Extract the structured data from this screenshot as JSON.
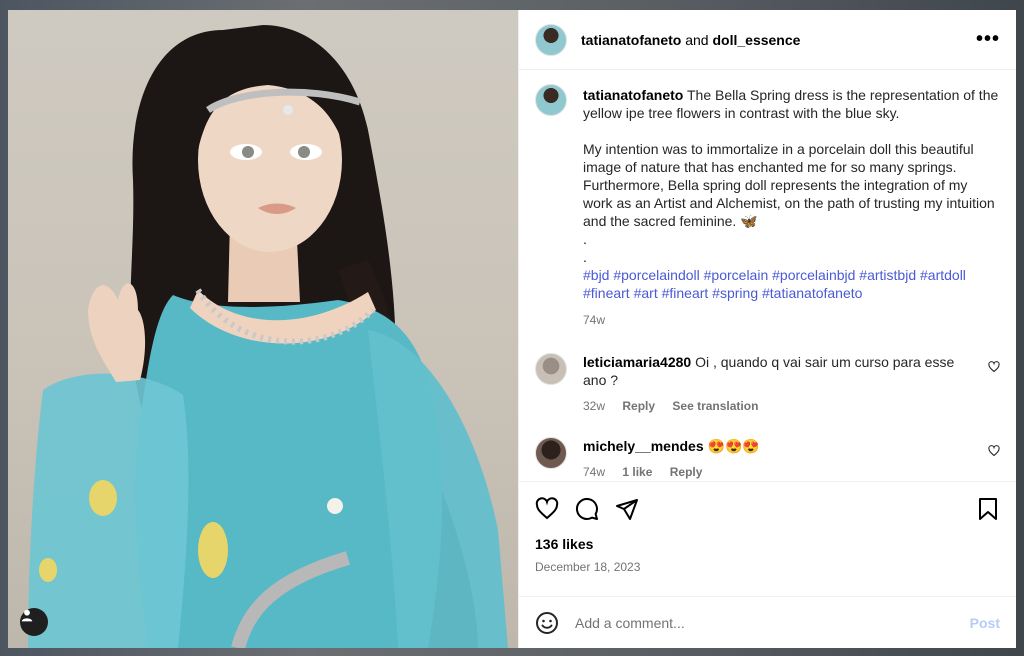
{
  "header": {
    "author": "tatianatofaneto",
    "connector": "and",
    "collaborator": "doll_essence",
    "more_icon": "more-horizontal-icon"
  },
  "caption": {
    "author": "tatianatofaneto",
    "line1": "The Bella Spring dress is the representation of the yellow ipe tree flowers in contrast with the blue sky.",
    "line2": "My intention was to immortalize in a porcelain doll this beautiful image of nature that has enchanted me for so many springs. Furthermore, Bella spring doll represents the integration of my work as an Artist and Alchemist, on the path of trusting my intuition and the sacred feminine. 🦋",
    "dots": ".\n.",
    "hashtags": "#bjd #porcelaindoll #porcelain #porcelainbjd #artistbjd #artdoll #fineart #art #fineart #spring #tatianatofaneto",
    "age": "74w"
  },
  "comments": [
    {
      "user": "leticiamaria4280",
      "text": "Oi , quando q vai sair um curso para esse ano ?",
      "age": "32w",
      "reply": "Reply",
      "translate": "See translation"
    },
    {
      "user": "michely__mendes",
      "text": "😍😍😍",
      "age": "74w",
      "likes": "1 like",
      "reply": "Reply"
    }
  ],
  "actions": {
    "icons": [
      "heart-icon",
      "comment-icon",
      "share-icon",
      "bookmark-icon"
    ],
    "likes": "136 likes",
    "date": "December 18, 2023"
  },
  "composer": {
    "emoji_icon": "emoji-icon",
    "placeholder": "Add a comment...",
    "post": "Post"
  },
  "photo": {
    "tag_icon": "user-tag-icon"
  },
  "colors": {
    "link": "#4a5ad6",
    "post_disabled": "#b3cdf8",
    "muted": "#737373"
  }
}
